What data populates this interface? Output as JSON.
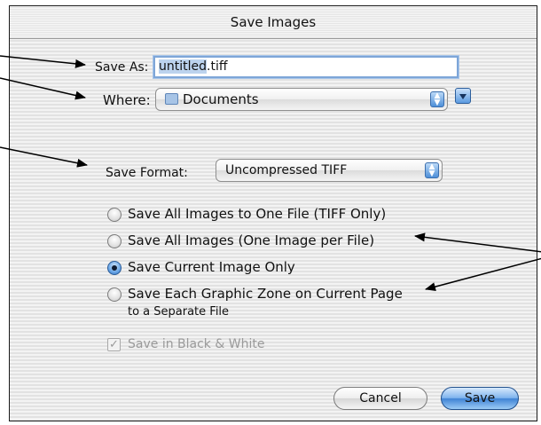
{
  "dialog": {
    "title": "Save Images",
    "save_as": {
      "label": "Save As:",
      "value_selected": "untitled",
      "value_rest": ".tiff"
    },
    "where": {
      "label": "Where:",
      "value": "Documents",
      "folder_icon": "folder-icon"
    },
    "save_format": {
      "label": "Save Format:",
      "value": "Uncompressed TIFF"
    },
    "options": [
      {
        "label": "Save All Images to One File (TIFF Only)",
        "selected": false
      },
      {
        "label": "Save All Images (One Image per File)",
        "selected": false
      },
      {
        "label": "Save Current Image Only",
        "selected": true
      },
      {
        "label": "Save Each Graphic Zone on Current Page",
        "label_line2": "to a Separate File",
        "selected": false
      }
    ],
    "black_white": {
      "label": "Save in Black & White",
      "checked": true,
      "enabled": false
    },
    "buttons": {
      "cancel": "Cancel",
      "save": "Save"
    }
  },
  "colors": {
    "accent": "#4d8fd8",
    "field_focus": "#7ea6d8",
    "selection": "#bcd3ee"
  }
}
